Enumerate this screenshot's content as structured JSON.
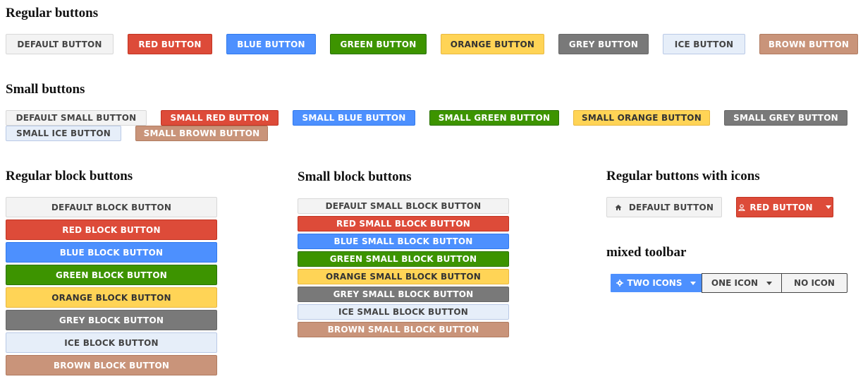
{
  "headings": {
    "regular": "Regular buttons",
    "small": "Small buttons",
    "regular_block": "Regular block buttons",
    "small_block": "Small block buttons",
    "with_icons": "Regular buttons with icons",
    "toolbar": "mixed toolbar"
  },
  "regular": [
    "DEFAULT BUTTON",
    "RED BUTTON",
    "BLUE BUTTON",
    "GREEN BUTTON",
    "ORANGE BUTTON",
    "GREY BUTTON",
    "ICE BUTTON",
    "BROWN BUTTON"
  ],
  "small": [
    "DEFAULT SMALL BUTTON",
    "SMALL RED BUTTON",
    "SMALL BLUE BUTTON",
    "SMALL GREEN BUTTON",
    "SMALL ORANGE BUTTON",
    "SMALL GREY BUTTON",
    "SMALL ICE BUTTON",
    "SMALL BROWN BUTTON"
  ],
  "block": [
    "DEFAULT BLOCK BUTTON",
    "RED BLOCK BUTTON",
    "BLUE BLOCK BUTTON",
    "GREEN BLOCK BUTTON",
    "ORANGE BLOCK BUTTON",
    "GREY BLOCK BUTTON",
    "ICE BLOCK BUTTON",
    "BROWN BLOCK BUTTON"
  ],
  "small_block": [
    "DEFAULT SMALL BLOCK BUTTON",
    "RED SMALL BLOCK BUTTON",
    "BLUE SMALL BLOCK BUTTON",
    "GREEN SMALL BLOCK BUTTON",
    "ORANGE SMALL BLOCK BUTTON",
    "GREY SMALL BLOCK BUTTON",
    "ICE SMALL BLOCK BUTTON",
    "BROWN SMALL BLOCK BUTTON"
  ],
  "icon_buttons": {
    "default": {
      "label": "DEFAULT BUTTON",
      "icon": "home-icon"
    },
    "red": {
      "label": "RED BUTTON",
      "icon": "user-icon",
      "trailing_icon": "caret-down-icon"
    }
  },
  "toolbar": {
    "two_icons": {
      "label": "TWO ICONS",
      "icon": "gear-icon",
      "trailing_icon": "caret-down-icon"
    },
    "one_icon": {
      "label": "ONE ICON",
      "trailing_icon": "caret-down-icon"
    },
    "no_icon": {
      "label": "NO ICON"
    }
  },
  "colors": {
    "default": "#f3f3f3",
    "red": "#dd4b39",
    "blue": "#4d90fe",
    "green": "#3d9400",
    "orange": "#ffd456",
    "grey": "#797979",
    "ice": "#e6eef9",
    "brown": "#c9947a"
  }
}
